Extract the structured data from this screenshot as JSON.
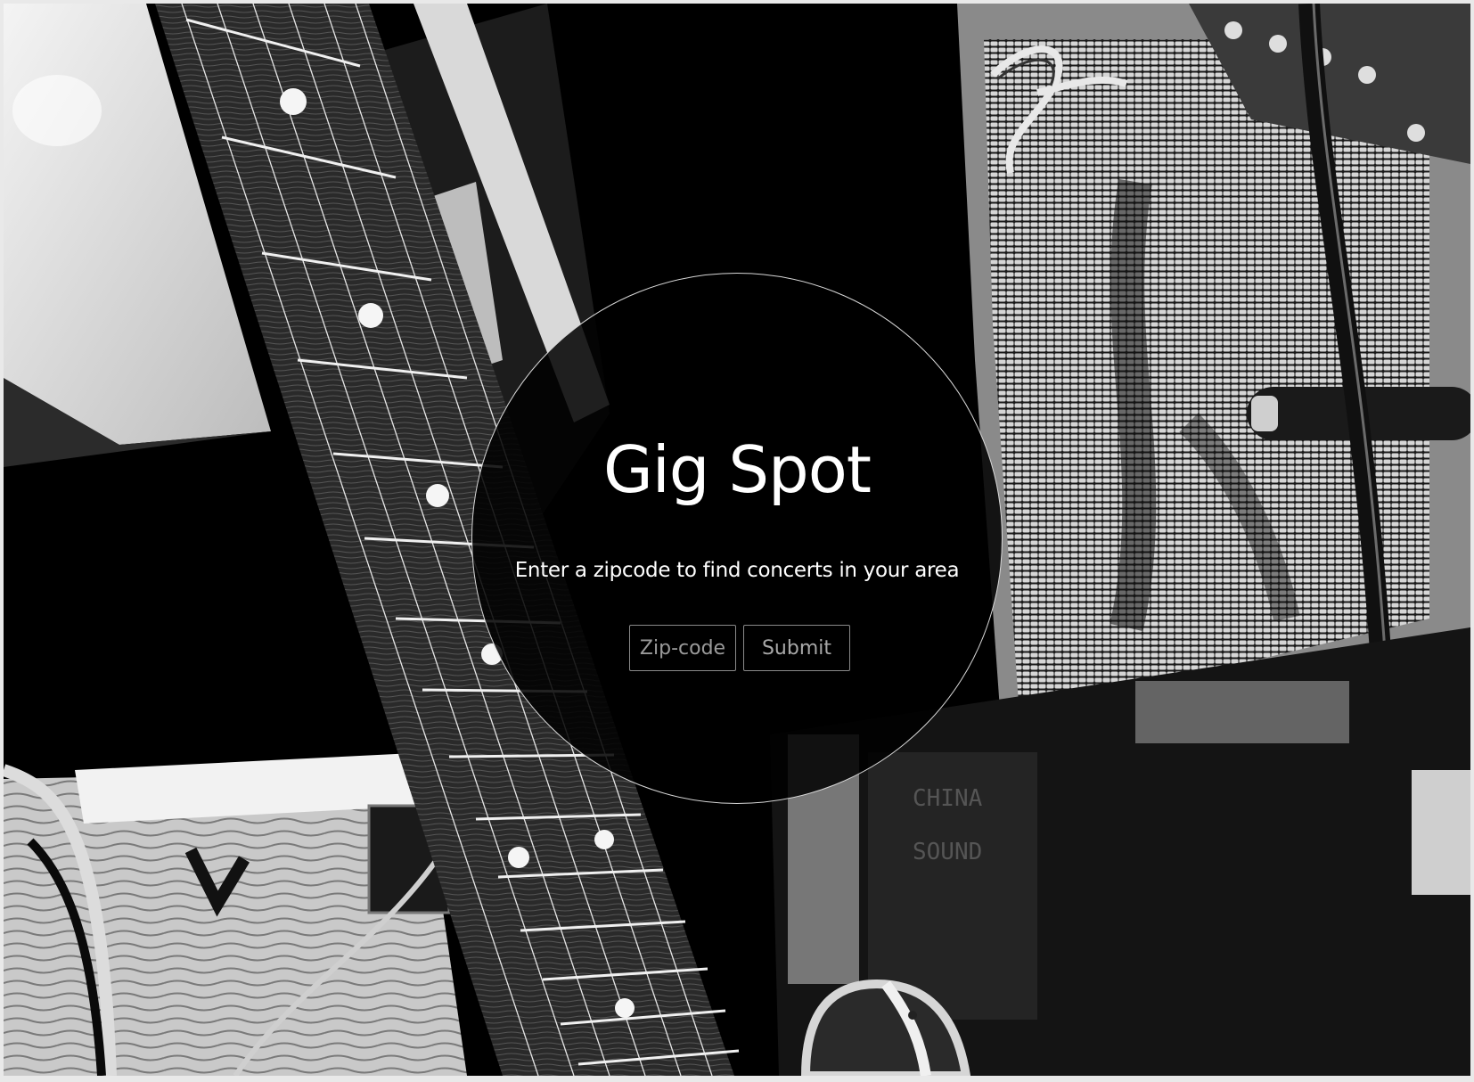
{
  "hero": {
    "title": "Gig Spot",
    "subtitle": "Enter a zipcode to find concerts in your area"
  },
  "form": {
    "zip_placeholder": "Zip-code",
    "zip_value": "",
    "submit_label": "Submit"
  },
  "background": {
    "description_icon": "guitar-and-amplifier-photo"
  }
}
